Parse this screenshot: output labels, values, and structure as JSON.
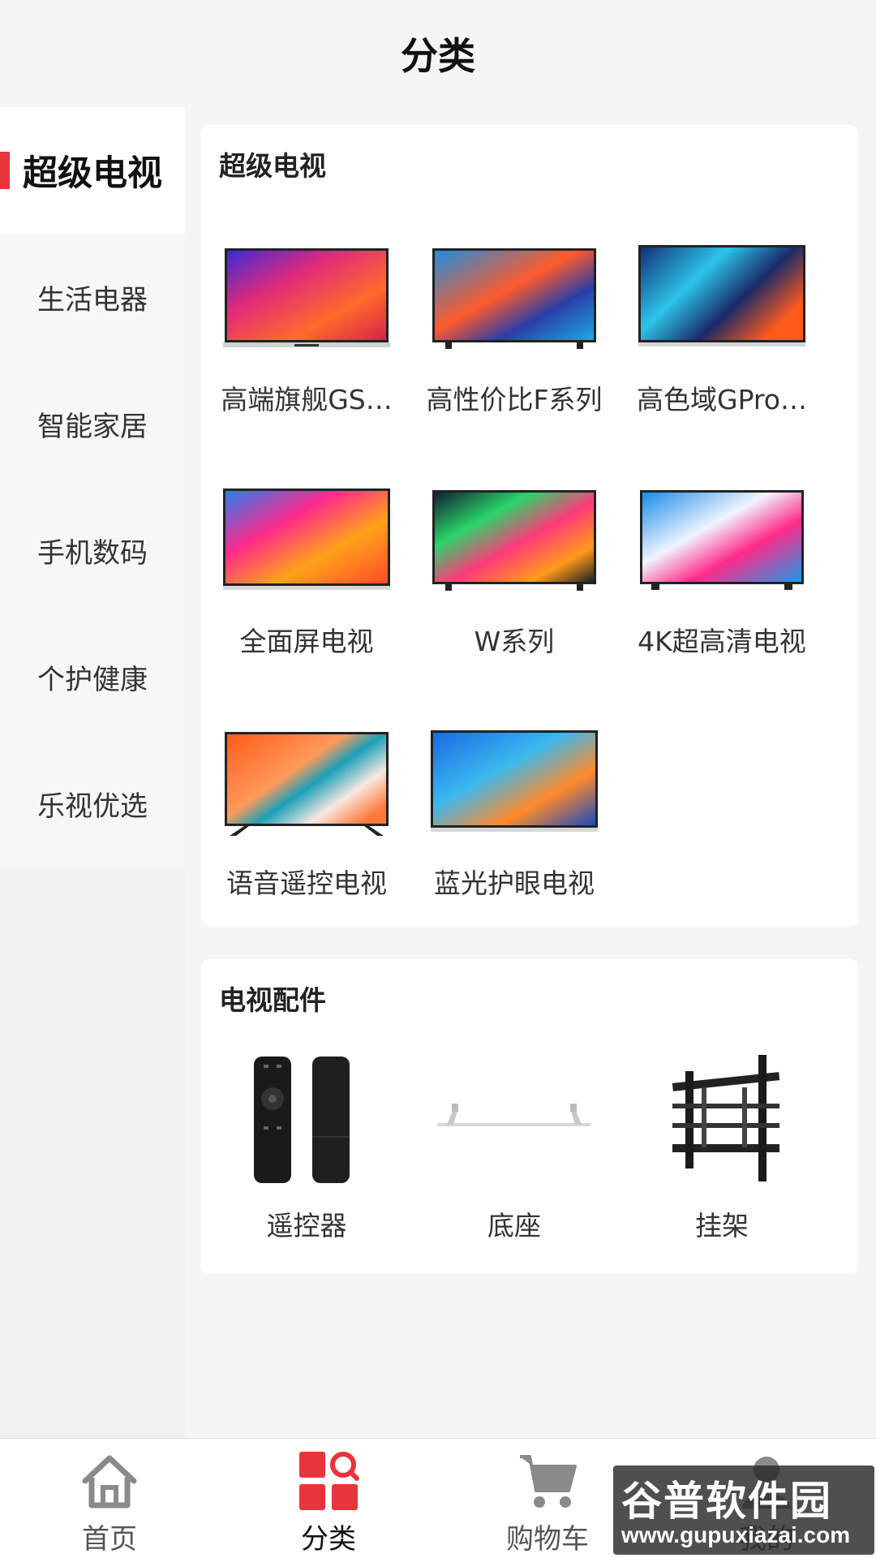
{
  "header": {
    "title": "分类"
  },
  "sidebar": {
    "items": [
      {
        "label": "超级电视",
        "active": true
      },
      {
        "label": "生活电器",
        "active": false
      },
      {
        "label": "智能家居",
        "active": false
      },
      {
        "label": "手机数码",
        "active": false
      },
      {
        "label": "个护健康",
        "active": false
      },
      {
        "label": "乐视优选",
        "active": false
      }
    ]
  },
  "sections": [
    {
      "title": "超级电视",
      "items": [
        {
          "label": "高端旗舰GS…",
          "icon": "tv-image"
        },
        {
          "label": "高性价比F系列",
          "icon": "tv-image"
        },
        {
          "label": "高色域GPro…",
          "icon": "tv-image"
        },
        {
          "label": "全面屏电视",
          "icon": "tv-image"
        },
        {
          "label": "W系列",
          "icon": "tv-image"
        },
        {
          "label": "4K超高清电视",
          "icon": "tv-image"
        },
        {
          "label": "语音遥控电视",
          "icon": "tv-image"
        },
        {
          "label": "蓝光护眼电视",
          "icon": "tv-image"
        }
      ]
    },
    {
      "title": "电视配件",
      "items": [
        {
          "label": "遥控器",
          "icon": "remote-control-image"
        },
        {
          "label": "底座",
          "icon": "tv-stand-image"
        },
        {
          "label": "挂架",
          "icon": "wall-mount-image"
        }
      ]
    }
  ],
  "tabbar": {
    "tabs": [
      {
        "label": "首页",
        "icon": "home-icon",
        "active": false
      },
      {
        "label": "分类",
        "icon": "category-icon",
        "active": true
      },
      {
        "label": "购物车",
        "icon": "cart-icon",
        "active": false
      },
      {
        "label": "我的",
        "icon": "profile-icon",
        "active": false
      }
    ]
  },
  "watermark": {
    "main": "谷普软件园",
    "sub": "www.gupuxiazai.com"
  },
  "colors": {
    "accent": "#e8343a",
    "icon_gray": "#8a8a8a"
  }
}
